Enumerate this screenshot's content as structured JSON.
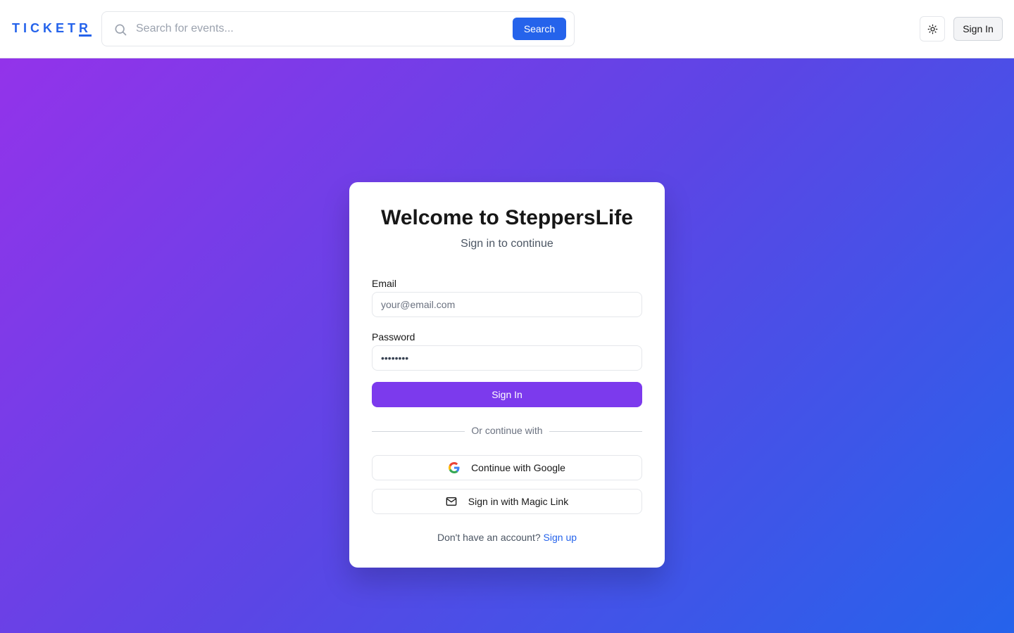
{
  "header": {
    "logo_main": "TICKET",
    "logo_last": "R",
    "search_placeholder": "Search for events...",
    "search_button": "Search",
    "sign_in_button": "Sign In"
  },
  "card": {
    "title": "Welcome to SteppersLife",
    "subtitle": "Sign in to continue",
    "email_label": "Email",
    "email_placeholder": "your@email.com",
    "password_label": "Password",
    "password_value": "••••••••",
    "sign_in_button": "Sign In",
    "divider_text": "Or continue with",
    "google_button": "Continue with Google",
    "magic_link_button": "Sign in with Magic Link",
    "signup_prompt": "Don't have an account?",
    "signup_link": "Sign up"
  },
  "colors": {
    "brand_blue": "#2563eb",
    "primary_purple": "#7c3aed",
    "gradient_start": "#9333ea",
    "gradient_end": "#2563eb"
  },
  "icons": [
    "search-icon",
    "sun-icon",
    "google-icon",
    "mail-icon"
  ]
}
